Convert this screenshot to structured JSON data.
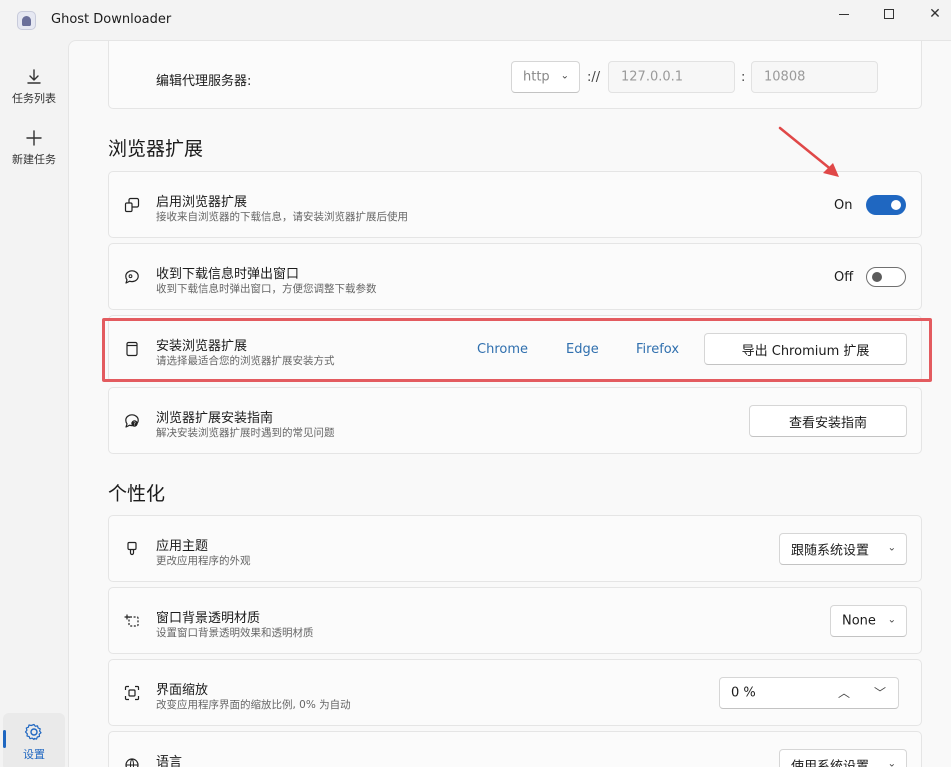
{
  "window": {
    "title": "Ghost Downloader"
  },
  "sidebar": {
    "items": [
      {
        "label": "任务列表"
      },
      {
        "label": "新建任务"
      }
    ],
    "settings_label": "设置"
  },
  "proxy": {
    "label": "编辑代理服务器:",
    "scheme": "http",
    "scheme_sep": "://",
    "host_placeholder": "127.0.0.1",
    "port_sep": ":",
    "port_placeholder": "10808"
  },
  "browser_section": {
    "header": "浏览器扩展",
    "enable_ext": {
      "title": "启用浏览器扩展",
      "desc": "接收来自浏览器的下载信息，请安装浏览器扩展后使用",
      "state_label": "On",
      "on": true
    },
    "popup": {
      "title": "收到下载信息时弹出窗口",
      "desc": "收到下载信息时弹出窗口，方便您调整下载参数",
      "state_label": "Off",
      "on": false
    },
    "install": {
      "title": "安装浏览器扩展",
      "desc": "请选择最适合您的浏览器扩展安装方式",
      "links": [
        "Chrome",
        "Edge",
        "Firefox"
      ],
      "export_button": "导出 Chromium 扩展"
    },
    "guide": {
      "title": "浏览器扩展安装指南",
      "desc": "解决安装浏览器扩展时遇到的常见问题",
      "button": "查看安装指南"
    }
  },
  "personal_section": {
    "header": "个性化",
    "theme": {
      "title": "应用主题",
      "desc": "更改应用程序的外观",
      "value": "跟随系统设置"
    },
    "material": {
      "title": "窗口背景透明材质",
      "desc": "设置窗口背景透明效果和透明材质",
      "value": "None"
    },
    "zoom": {
      "title": "界面缩放",
      "desc": "改变应用程序界面的缩放比例, 0% 为自动",
      "value": "0 %"
    },
    "language": {
      "title": "语言",
      "value": "使用系统设置"
    }
  },
  "colors": {
    "accent": "#1f67c1",
    "highlight": "#e35b5f"
  }
}
